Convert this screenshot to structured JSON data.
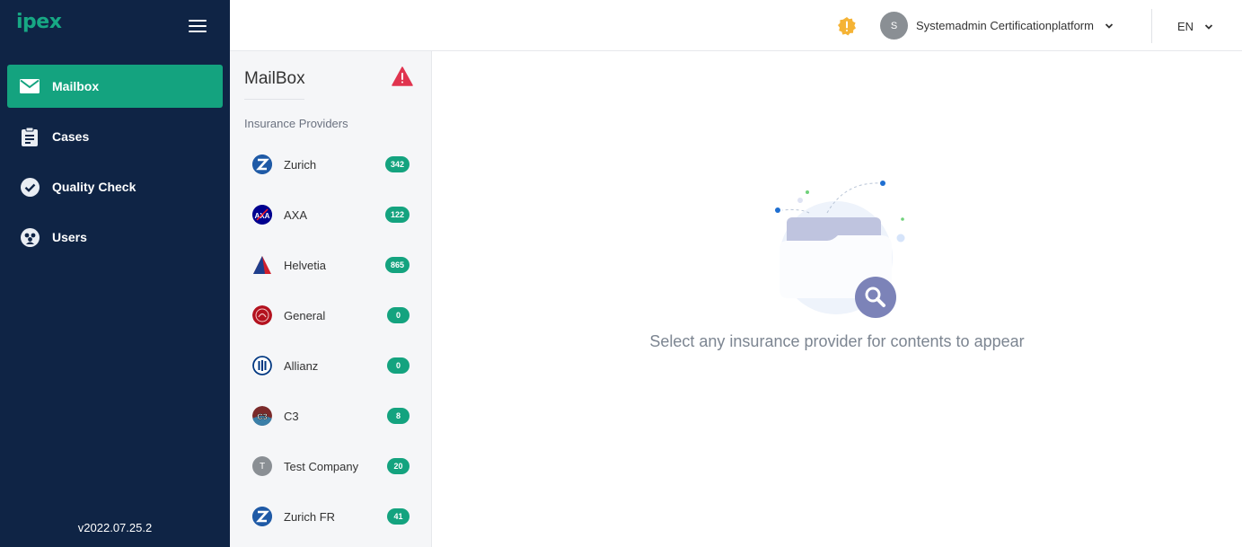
{
  "app": {
    "logo": "ipex",
    "version": "v2022.07.25.2"
  },
  "sidebar": {
    "items": [
      {
        "label": "Mailbox",
        "icon": "mail-icon",
        "active": true
      },
      {
        "label": "Cases",
        "icon": "clipboard-icon",
        "active": false
      },
      {
        "label": "Quality Check",
        "icon": "check-circle-icon",
        "active": false
      },
      {
        "label": "Users",
        "icon": "users-icon",
        "active": false
      }
    ]
  },
  "header": {
    "user": {
      "initial": "S",
      "name": "Systemadmin Certificationplatform"
    },
    "language": "EN"
  },
  "mailbox": {
    "title": "MailBox",
    "section_label": "Insurance Providers",
    "providers": [
      {
        "name": "Zurich",
        "count": "342",
        "logo": "zurich-logo"
      },
      {
        "name": "AXA",
        "count": "122",
        "logo": "axa-logo"
      },
      {
        "name": "Helvetia",
        "count": "865",
        "logo": "helvetia-logo"
      },
      {
        "name": "General",
        "count": "0",
        "logo": "general-logo"
      },
      {
        "name": "Allianz",
        "count": "0",
        "logo": "allianz-logo"
      },
      {
        "name": "C3",
        "count": "8",
        "logo": "c3-logo"
      },
      {
        "name": "Test Company",
        "count": "20",
        "logo": "initial-t-logo",
        "initial": "T"
      },
      {
        "name": "Zurich FR",
        "count": "41",
        "logo": "zurich-logo"
      }
    ]
  },
  "content": {
    "empty_message": "Select any insurance provider for contents to appear"
  },
  "colors": {
    "sidebar_bg": "#0f2445",
    "accent": "#14a37f",
    "warning": "#f5b335",
    "alert": "#e0344f"
  }
}
